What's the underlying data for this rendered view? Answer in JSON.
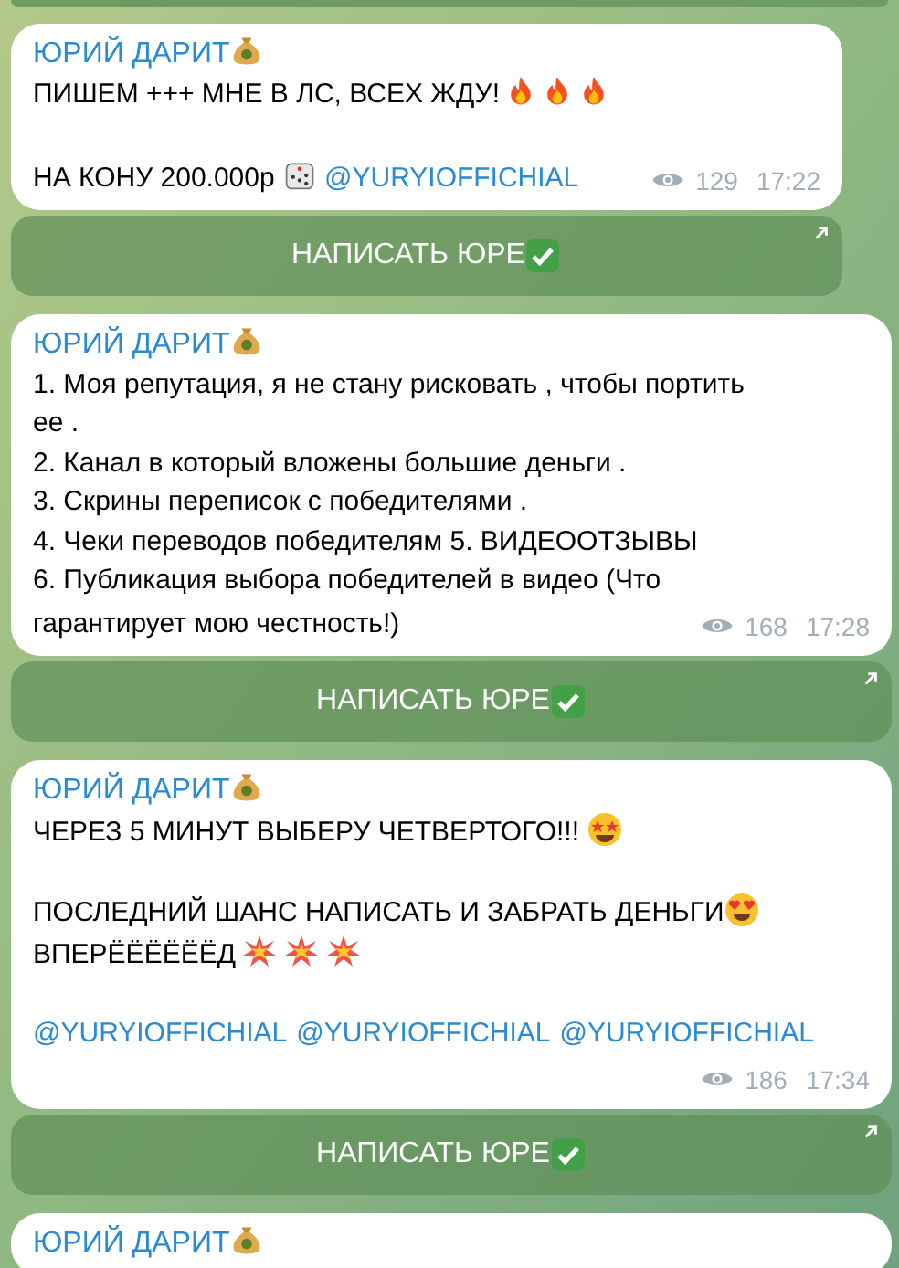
{
  "messages": [
    {
      "author": [
        {
          "kind": "text",
          "text": "ЮРИЙ ДАРИТ"
        },
        {
          "kind": "moneybag"
        }
      ],
      "paragraphs": [
        [
          [
            {
              "kind": "text",
              "text": "ПИШЕМ +++ МНЕ В ЛС, ВСЕХ ЖДУ!"
            },
            {
              "kind": "fire"
            },
            {
              "kind": "fire"
            },
            {
              "kind": "fire"
            }
          ]
        ],
        [
          [
            {
              "kind": "text",
              "text": "НА КОНУ 200.000р "
            },
            {
              "kind": "dice"
            },
            {
              "kind": "link",
              "text": "@YURYIOFFICHIAL"
            }
          ]
        ]
      ],
      "views": "129",
      "time": "17:22",
      "wide": false,
      "button": [
        {
          "kind": "text",
          "text": "НАПИСАТЬ ЮРЕ"
        },
        {
          "kind": "check"
        }
      ]
    },
    {
      "author": [
        {
          "kind": "text",
          "text": "ЮРИЙ ДАРИТ"
        },
        {
          "kind": "moneybag"
        }
      ],
      "paragraphs": [
        [
          [
            {
              "kind": "text",
              "text": "1. Моя репутация, я не стану рисковать , чтобы портить"
            }
          ],
          [
            {
              "kind": "text",
              "text": "ее ."
            }
          ],
          [
            {
              "kind": "text",
              "text": "2. Канал в который вложены большие деньги ."
            }
          ],
          [
            {
              "kind": "text",
              "text": "3. Скрины переписок с победителями ."
            }
          ],
          [
            {
              "kind": "text",
              "text": "4. Чеки переводов победителям 5. ВИДЕООТЗЫВЫ"
            }
          ],
          [
            {
              "kind": "text",
              "text": "6. Публикация выбора победителей в видео (Что"
            }
          ],
          [
            {
              "kind": "text",
              "text": "гарантирует мою честность!)"
            }
          ]
        ]
      ],
      "views": "168",
      "time": "17:28",
      "wide": true,
      "button": [
        {
          "kind": "text",
          "text": "НАПИСАТЬ ЮРЕ"
        },
        {
          "kind": "check"
        }
      ]
    },
    {
      "author": [
        {
          "kind": "text",
          "text": "ЮРИЙ ДАРИТ"
        },
        {
          "kind": "moneybag"
        }
      ],
      "paragraphs": [
        [
          [
            {
              "kind": "text",
              "text": "ЧЕРЕЗ 5 МИНУТ ВЫБЕРУ ЧЕТВЕРТОГО!!! "
            },
            {
              "kind": "starstruck"
            }
          ]
        ],
        [
          [
            {
              "kind": "text",
              "text": "ПОСЛЕДНИЙ ШАНС НАПИСАТЬ И ЗАБРАТЬ ДЕНЬГИ"
            },
            {
              "kind": "hearteyes"
            }
          ],
          [
            {
              "kind": "text",
              "text": "ВПЕРЁЁЁЁЁЁД"
            },
            {
              "kind": "boom"
            },
            {
              "kind": "boom"
            },
            {
              "kind": "boom"
            }
          ]
        ],
        [
          [
            {
              "kind": "link",
              "text": "@YURYIOFFICHIAL"
            },
            {
              "kind": "link",
              "text": "@YURYIOFFICHIAL"
            },
            {
              "kind": "link",
              "text": "@YURYIOFFICHIAL"
            }
          ]
        ]
      ],
      "views": "186",
      "time": "17:34",
      "wide": true,
      "button": [
        {
          "kind": "text",
          "text": "НАПИСАТЬ ЮРЕ"
        },
        {
          "kind": "check"
        }
      ]
    },
    {
      "author": [
        {
          "kind": "text",
          "text": "ЮРИЙ ДАРИТ"
        },
        {
          "kind": "moneybag"
        }
      ],
      "wide": true
    }
  ]
}
